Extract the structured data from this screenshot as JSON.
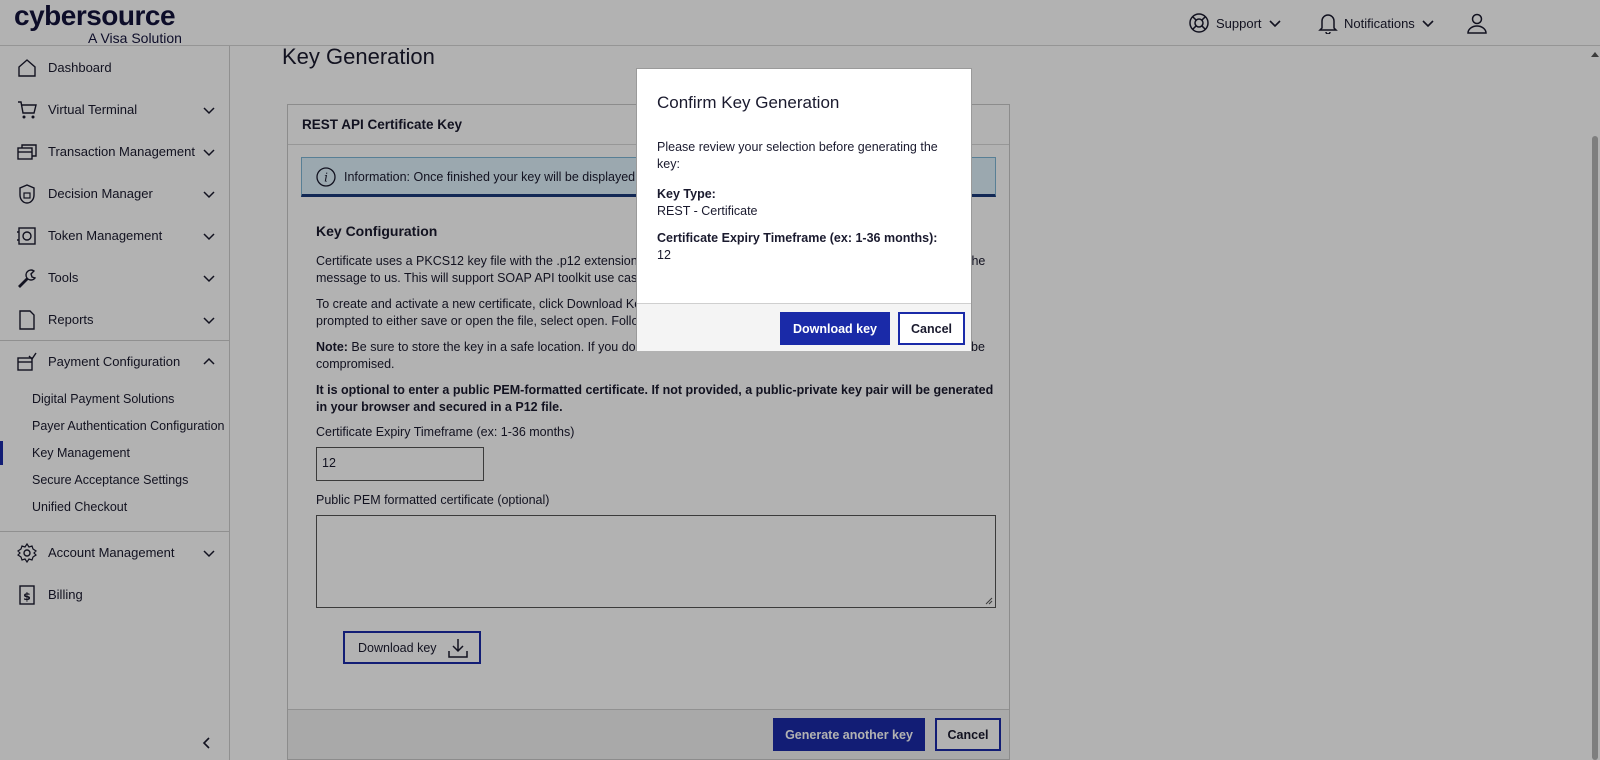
{
  "header": {
    "logo_word": "cybersource",
    "logo_sub": "A Visa Solution",
    "support": "Support",
    "notifications": "Notifications"
  },
  "sidebar": {
    "items": [
      {
        "label": "Dashboard",
        "icon": "home-icon"
      },
      {
        "label": "Virtual Terminal",
        "icon": "cart-icon"
      },
      {
        "label": "Transaction Management",
        "icon": "cards-icon"
      },
      {
        "label": "Decision Manager",
        "icon": "shield-icon"
      },
      {
        "label": "Token Management",
        "icon": "vault-icon"
      },
      {
        "label": "Tools",
        "icon": "wrench-icon"
      },
      {
        "label": "Reports",
        "icon": "document-icon"
      },
      {
        "label": "Payment Configuration",
        "icon": "payment-config-icon"
      },
      {
        "label": "Account Management",
        "icon": "gear-icon"
      },
      {
        "label": "Billing",
        "icon": "receipt-icon"
      }
    ],
    "sub_items": [
      "Digital Payment Solutions",
      "Payer Authentication Configuration",
      "Key Management",
      "Secure Acceptance Settings",
      "Unified Checkout"
    ],
    "active_sub": "Key Management"
  },
  "main": {
    "page_title": "Key Generation",
    "card_title": "REST API Certificate Key",
    "info_text": "Information: Once finished your key will be displayed",
    "section_title": "Key Configuration",
    "para1_line1": "Certificate uses a PKCS12 key file with the .p12 extension t",
    "para1_tail": "the",
    "para1_line2": "message to us. This will support SOAP API toolkit use cases",
    "para2_line1": "To create and activate a new certificate, click Download Ke",
    "para2_line2": "prompted to either save or open the file, select open. Follo",
    "note_label": "Note:",
    "note_line1": " Be sure to store the key in a safe location. If you do n",
    "note_tail": "be",
    "note_line2": "compromised.",
    "optional_text": "It is optional to enter a public PEM-formatted certificate. If not provided, a public-private key pair will be generated in your browser and secured in a P12 file.",
    "expiry_label": "Certificate Expiry Timeframe (ex: 1-36 months)",
    "expiry_value": "12",
    "pem_label": "Public PEM formatted certificate (optional)",
    "download_label": "Download key",
    "generate_label": "Generate another key",
    "cancel_label": "Cancel"
  },
  "modal": {
    "title": "Confirm Key Generation",
    "body": "Please review your selection before generating the key:",
    "key_type_label": "Key Type:",
    "key_type_value": "REST - Certificate",
    "expiry_label": "Certificate Expiry Timeframe (ex: 1-36 months):",
    "expiry_value": "12",
    "download_label": "Download key",
    "cancel_label": "Cancel"
  },
  "colors": {
    "brand": "#1a2aa8",
    "info_bg": "#dff1fb"
  }
}
